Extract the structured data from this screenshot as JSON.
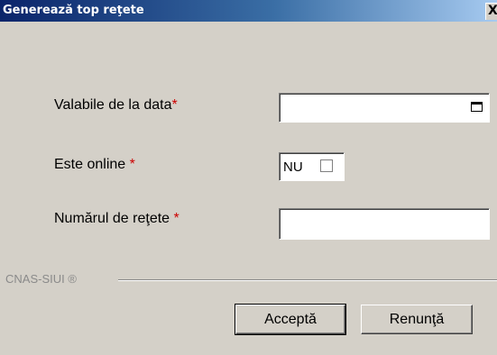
{
  "window": {
    "title": "Generează top reţete",
    "close_glyph": "X"
  },
  "form": {
    "date_label": "Valabile de la data",
    "online_label": "Este online ",
    "online_value": "NU",
    "online_checked": false,
    "count_label": "Numărul de reţete ",
    "required_mark": "*",
    "date_value": "",
    "count_value": ""
  },
  "footer": {
    "brand": "CNAS-SIUI ®",
    "accept_label": "Acceptă",
    "cancel_label": "Renunţă"
  },
  "colors": {
    "dialog_bg": "#d4d0c8",
    "title_start": "#0a246a",
    "title_end": "#a6caf0",
    "required": "#cc0000"
  },
  "icons": {
    "calendar": "calendar-icon",
    "close": "close-icon"
  }
}
